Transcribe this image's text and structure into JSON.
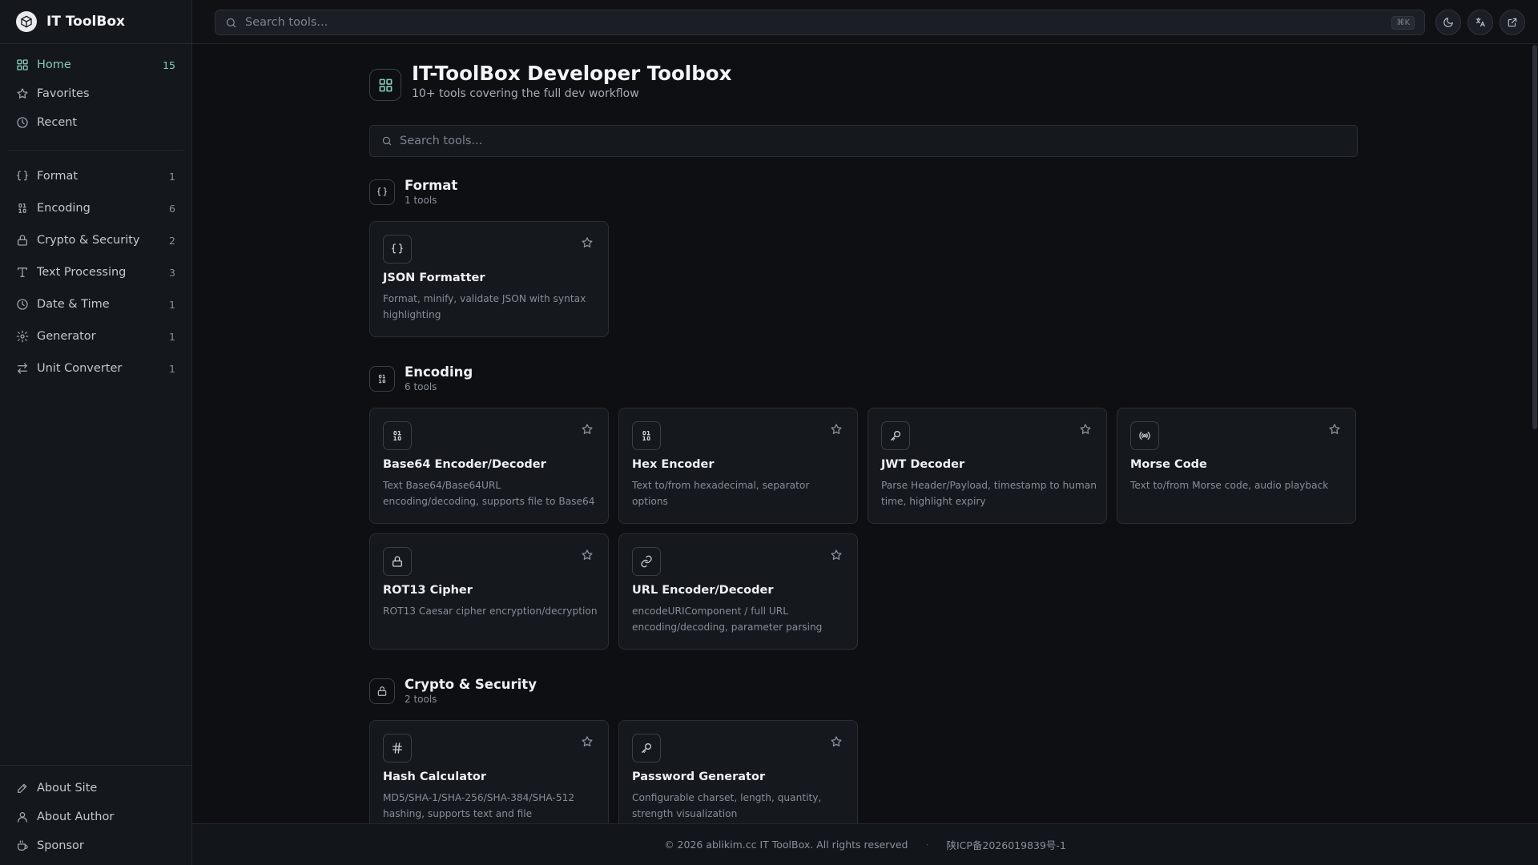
{
  "brand": {
    "name": "IT ToolBox"
  },
  "sidebar": {
    "top_items": [
      {
        "label": "Home",
        "count": "15",
        "icon": "grid-icon"
      },
      {
        "label": "Favorites",
        "count": "",
        "icon": "star-icon"
      },
      {
        "label": "Recent",
        "count": "",
        "icon": "clock-icon"
      }
    ],
    "categories": [
      {
        "label": "Format",
        "count": "1",
        "icon": "braces-icon"
      },
      {
        "label": "Encoding",
        "count": "6",
        "icon": "binary-icon"
      },
      {
        "label": "Crypto & Security",
        "count": "2",
        "icon": "lock-icon"
      },
      {
        "label": "Text Processing",
        "count": "3",
        "icon": "type-icon"
      },
      {
        "label": "Date & Time",
        "count": "1",
        "icon": "clock-icon"
      },
      {
        "label": "Generator",
        "count": "1",
        "icon": "gear-icon"
      },
      {
        "label": "Unit Converter",
        "count": "1",
        "icon": "swap-icon"
      }
    ],
    "bottom_items": [
      {
        "label": "About Site",
        "icon": "pen-icon"
      },
      {
        "label": "About Author",
        "icon": "user-icon"
      },
      {
        "label": "Sponsor",
        "icon": "coffee-icon"
      }
    ]
  },
  "topbar": {
    "search_placeholder": "Search tools...",
    "shortcut": "⌘K",
    "buttons": [
      "moon-icon",
      "translate-icon",
      "external-link-icon"
    ]
  },
  "page": {
    "title": "IT-ToolBox Developer Toolbox",
    "subtitle": "10+ tools covering the full dev workflow",
    "search_placeholder": "Search tools..."
  },
  "sections": [
    {
      "title": "Format",
      "count": "1 tools",
      "icon": "braces-icon",
      "tools": [
        {
          "name": "JSON Formatter",
          "desc": "Format, minify, validate JSON with syntax highlighting",
          "icon": "braces-icon"
        }
      ]
    },
    {
      "title": "Encoding",
      "count": "6 tools",
      "icon": "binary-icon",
      "tools": [
        {
          "name": "Base64 Encoder/Decoder",
          "desc": "Text Base64/Base64URL encoding/decoding, supports file to Base64",
          "icon": "binary-icon"
        },
        {
          "name": "Hex Encoder",
          "desc": "Text to/from hexadecimal, separator options",
          "icon": "binary-icon"
        },
        {
          "name": "JWT Decoder",
          "desc": "Parse Header/Payload, timestamp to human time, highlight expiry",
          "icon": "key-icon"
        },
        {
          "name": "Morse Code",
          "desc": "Text to/from Morse code, audio playback",
          "icon": "radio-icon"
        },
        {
          "name": "ROT13 Cipher",
          "desc": "ROT13 Caesar cipher encryption/decryption",
          "icon": "lock-icon"
        },
        {
          "name": "URL Encoder/Decoder",
          "desc": "encodeURIComponent / full URL encoding/decoding, parameter parsing",
          "icon": "link-icon"
        }
      ]
    },
    {
      "title": "Crypto & Security",
      "count": "2 tools",
      "icon": "lock-icon",
      "tools": [
        {
          "name": "Hash Calculator",
          "desc": "MD5/SHA-1/SHA-256/SHA-384/SHA-512 hashing, supports text and file",
          "icon": "hash-icon"
        },
        {
          "name": "Password Generator",
          "desc": "Configurable charset, length, quantity, strength visualization",
          "icon": "key-icon"
        }
      ]
    }
  ],
  "footer": {
    "copyright": "© 2026 ablikim.cc IT ToolBox. All rights reserved",
    "separator": "·",
    "icp": "陕ICP备2026019839号-1"
  },
  "colors": {
    "accent": "#86cdb9",
    "background": "#0d0f13",
    "sidebar": "#14171c",
    "card": "#15181d"
  }
}
